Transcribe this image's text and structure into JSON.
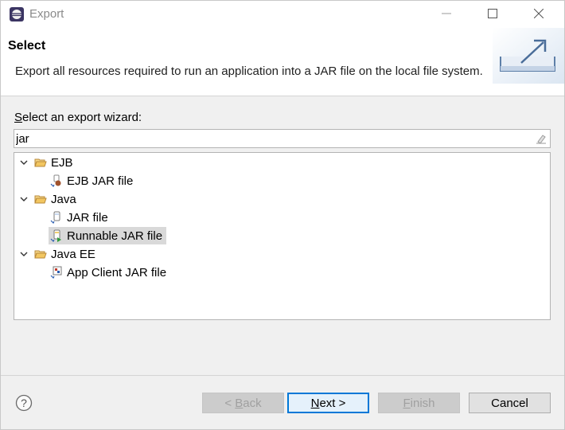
{
  "window": {
    "title": "Export"
  },
  "titlebar": {
    "app_icon": "eclipse-icon",
    "minimize_icon": "minimize-icon",
    "maximize_icon": "maximize-icon",
    "close_icon": "close-icon"
  },
  "banner": {
    "title": "Select",
    "description": "Export all resources required to run an application into a JAR file on the local file system.",
    "graphic": "export-icon"
  },
  "wizard": {
    "label_first": "S",
    "label_rest": "elect an export wizard:",
    "filter_value": "jar",
    "clear_icon": "clear-icon"
  },
  "tree": [
    {
      "label": "EJB",
      "icon": "folder-open-icon",
      "level": 0,
      "expanded": true
    },
    {
      "label": "EJB JAR file",
      "icon": "ejb-jar-icon",
      "level": 1
    },
    {
      "label": "Java",
      "icon": "folder-open-icon",
      "level": 0,
      "expanded": true
    },
    {
      "label": "JAR file",
      "icon": "jar-icon",
      "level": 1
    },
    {
      "label": "Runnable JAR file",
      "icon": "runnable-jar-icon",
      "level": 1,
      "selected": true
    },
    {
      "label": "Java EE",
      "icon": "folder-open-icon",
      "level": 0,
      "expanded": true
    },
    {
      "label": "App Client JAR file",
      "icon": "app-client-jar-icon",
      "level": 1
    }
  ],
  "buttons": {
    "help_icon": "help-icon",
    "back_prefix": "< ",
    "back_mnemonic": "B",
    "back_rest": "ack",
    "next_mnemonic": "N",
    "next_rest": "ext >",
    "finish_mnemonic": "F",
    "finish_rest": "inish",
    "cancel": "Cancel"
  },
  "colors": {
    "default_button_border": "#0078d7",
    "selection": "#d9d9d9",
    "folder": "#e8b84a"
  }
}
